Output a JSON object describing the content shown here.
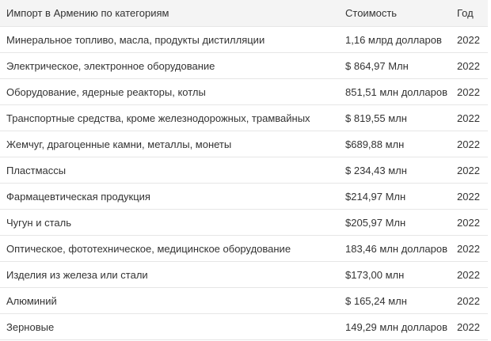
{
  "table": {
    "headers": {
      "category": "Импорт в Армению по категориям",
      "value": "Стоимость",
      "year": "Год"
    },
    "rows": [
      {
        "category": "Минеральное топливо, масла, продукты дистилляции",
        "value": "1,16 млрд долларов",
        "year": "2022"
      },
      {
        "category": "Электрическое, электронное оборудование",
        "value": "$ 864,97 Млн",
        "year": "2022"
      },
      {
        "category": "Оборудование, ядерные реакторы, котлы",
        "value": "851,51 млн долларов",
        "year": "2022"
      },
      {
        "category": "Транспортные средства, кроме железнодорожных, трамвайных",
        "value": "$ 819,55 млн",
        "year": "2022"
      },
      {
        "category": "Жемчуг, драгоценные камни, металлы, монеты",
        "value": "$689,88 млн",
        "year": "2022"
      },
      {
        "category": "Пластмассы",
        "value": "$ 234,43 млн",
        "year": "2022"
      },
      {
        "category": "Фармацевтическая продукция",
        "value": "$214,97 Млн",
        "year": "2022"
      },
      {
        "category": "Чугун и сталь",
        "value": "$205,97 Млн",
        "year": "2022"
      },
      {
        "category": "Оптическое, фототехническое, медицинское оборудование",
        "value": "183,46 млн долларов",
        "year": "2022"
      },
      {
        "category": "Изделия из железа или стали",
        "value": "$173,00 млн",
        "year": "2022"
      },
      {
        "category": "Алюминий",
        "value": "$ 165,24 млн",
        "year": "2022"
      },
      {
        "category": "Зерновые",
        "value": "149,29 млн долларов",
        "year": "2022"
      }
    ]
  },
  "colors": {
    "header_bg": "#f4f4f4",
    "row_border": "#e6e6e6",
    "text": "#333333"
  }
}
